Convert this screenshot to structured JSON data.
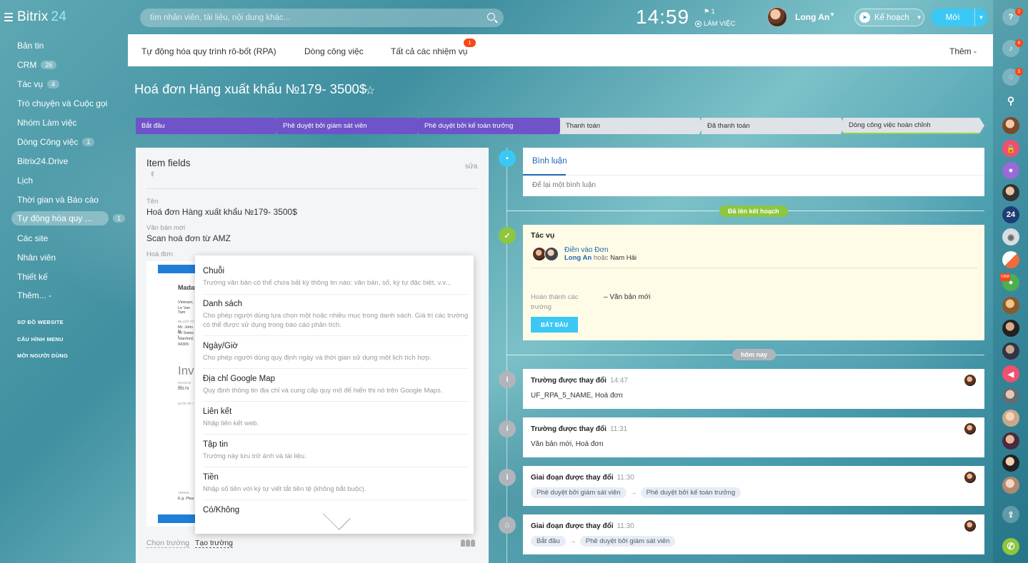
{
  "app": {
    "logo_name": "Bitrix",
    "logo_num": "24"
  },
  "search": {
    "placeholder": "tìm nhân viên, tài liệu, nội dung khác..."
  },
  "clock": {
    "time": "14:59",
    "flag_count": "1",
    "status": "LÀM VIỆC"
  },
  "user": {
    "name": "Long An"
  },
  "buttons": {
    "plan": "Kế hoạch",
    "new": "Mới"
  },
  "sidebar": {
    "items": [
      {
        "label": "Bản tin",
        "badge": ""
      },
      {
        "label": "CRM",
        "badge": "26"
      },
      {
        "label": "Tác vụ",
        "badge": "4"
      },
      {
        "label": "Trò chuyện và Cuộc gọi",
        "badge": ""
      },
      {
        "label": "Nhóm Làm việc",
        "badge": ""
      },
      {
        "label": "Dòng Công việc",
        "badge": "1"
      },
      {
        "label": "Bitrix24.Drive",
        "badge": ""
      },
      {
        "label": "Lịch",
        "badge": ""
      },
      {
        "label": "Thời gian và Báo cáo",
        "badge": ""
      },
      {
        "label": "Tự động hóa quy ...",
        "badge": "1"
      },
      {
        "label": "Các site",
        "badge": ""
      },
      {
        "label": "Nhân viên",
        "badge": ""
      },
      {
        "label": "Thiết kế",
        "badge": ""
      },
      {
        "label": "Thêm... -",
        "badge": ""
      }
    ],
    "small": [
      "SƠ ĐỒ WEBSITE",
      "CẤU HÌNH MENU",
      "MỜI NGƯỜI DÙNG"
    ]
  },
  "top_nav": {
    "tabs": [
      "Tự động hóa quy trình rô-bốt (RPA)",
      "Dòng công việc",
      "Tất cả các nhiệm vụ"
    ],
    "badge": "1",
    "more": "Thêm -"
  },
  "page": {
    "title": "Hoá đơn Hàng xuất khẩu №179- 3500$"
  },
  "stages": [
    "Bắt đầu",
    "Phê duyệt bởi giám sát viên",
    "Phê duyệt bởi kế toán trưởng",
    "Thanh toán",
    "Đã thanh toán",
    "Dòng công việc hoàn chỉnh"
  ],
  "fields": {
    "title": "Item fields",
    "edit": "sửa",
    "name_label": "Tên",
    "name_value": "Hoá đơn Hàng xuất khẩu №179- 3500$",
    "text_label": "Văn bản mới",
    "text_value": "Scan hoá đơn từ AMZ",
    "invoice_label": "Hoá đơn",
    "invoice_snippets": [
      "Madar",
      "Vietnam,",
      "Le Van Tam",
      "BILLED TO",
      "Mr. John N",
      "40 Swiss I",
      "Stanford,",
      "94305",
      "Inv",
      "INVOICE NU",
      "00179",
      "DATE OF I",
      "TERMS",
      "E.g. Plea"
    ],
    "choose": "Chọn trường",
    "create": "Tạo trường"
  },
  "dropdown": [
    {
      "name": "Chuỗi",
      "desc": "Trường văn bản có thể chứa bất kỳ thông tin nào: văn bản, số, ký tự đặc biệt, v.v..."
    },
    {
      "name": "Danh sách",
      "desc": "Cho phép người dùng lựa chọn một hoặc nhiều mục trong danh sách. Giá trị các trường có thể được sử dụng trong báo cáo phân tích."
    },
    {
      "name": "Ngày/Giờ",
      "desc": "Cho phép người dùng quy định ngày và thời gian sử dụng một lịch tích hợp."
    },
    {
      "name": "Địa chỉ Google Map",
      "desc": "Quy định thông tin địa chỉ và cung cấp quy mô để hiển thị nó trên Google Maps."
    },
    {
      "name": "Liên kết",
      "desc": "Nhập liên kết web."
    },
    {
      "name": "Tập tin",
      "desc": "Trường này lưu trữ ảnh và tài liệu."
    },
    {
      "name": "Tiền",
      "desc": "Nhập số tiền với ký tự viết tắt tiền tệ (không bắt buộc)."
    },
    {
      "name": "Có/Không",
      "desc": ""
    }
  ],
  "timeline": {
    "comment_tab": "Bình luận",
    "comment_placeholder": "Để lại một bình luận",
    "pill_planned": "Đã lên kết hoạch",
    "task": {
      "title": "Tác vụ",
      "link": "Điền vào Đơn",
      "person1": "Long An",
      "or": "hoặc",
      "person2": "Nam Hải",
      "complete_label": "Hoàn thành các trường",
      "complete_value": "– Văn bản mới",
      "start": "BẮT ĐẦU"
    },
    "pill_today": "hôm nay",
    "events": [
      {
        "title": "Trường được thay đổi",
        "time": "14:47",
        "body": "UF_RPA_5_NAME, Hoá đơn"
      },
      {
        "title": "Trường được thay đổi",
        "time": "11:31",
        "body": "Văn bản mới, Hoá đơn"
      },
      {
        "title": "Giai đoạn được thay đổi",
        "time": "11:30",
        "from": "Phê duyệt bởi giám sát viên",
        "to": "Phê duyệt bởi kế toán trưởng"
      },
      {
        "title": "Giai đoạn được thay đổi",
        "time": "11:30",
        "from": "Bắt đầu",
        "to": "Phê duyệt bởi giám sát viên"
      }
    ]
  },
  "right_bar": {
    "badges": [
      "2",
      "6",
      "5"
    ],
    "avatar_24": "24",
    "crm_tag": "CRM"
  },
  "colors": {
    "accent": "#3bc8f5",
    "stage_active": "#6f53c9",
    "link": "#2067b0",
    "badge": "#f54819",
    "planned": "#8dc63f"
  }
}
